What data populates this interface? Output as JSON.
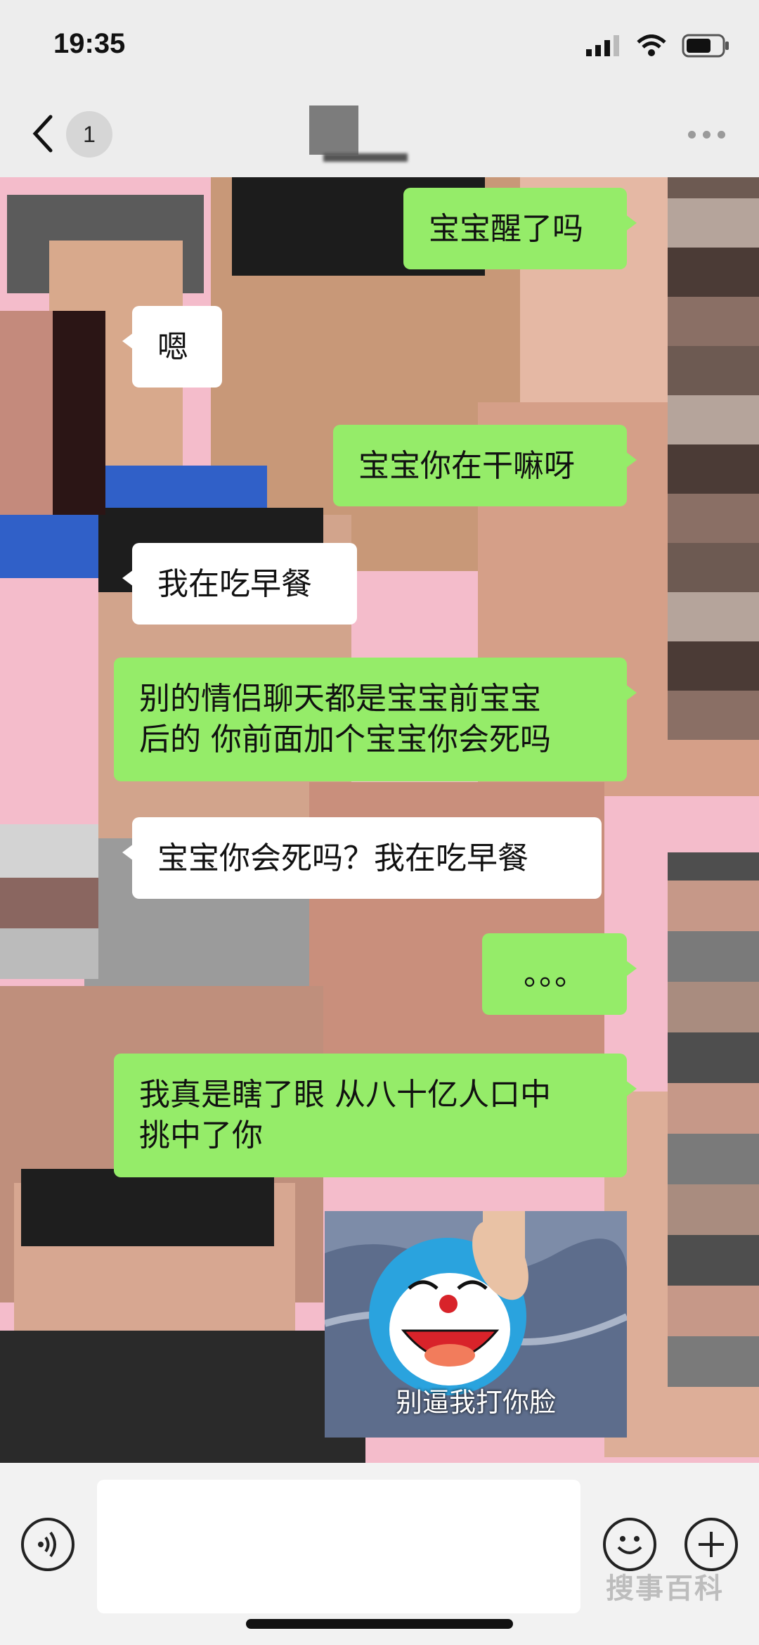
{
  "status_bar": {
    "time": "19:35",
    "icons": [
      "signal-icon",
      "wifi-icon",
      "battery-icon"
    ]
  },
  "header": {
    "back_icon": "chevron-left-icon",
    "unread_count": "1",
    "more_icon": "more-dots-icon"
  },
  "messages": [
    {
      "side": "me",
      "text": "宝宝醒了吗"
    },
    {
      "side": "them",
      "text": "嗯"
    },
    {
      "side": "me",
      "text": "宝宝你在干嘛呀"
    },
    {
      "side": "them",
      "text": "我在吃早餐"
    },
    {
      "side": "me",
      "line1": "别的情侣聊天都是宝宝前宝宝",
      "line2": "后的 你前面加个宝宝你会死吗"
    },
    {
      "side": "them",
      "text": "宝宝你会死吗？我在吃早餐"
    },
    {
      "side": "me",
      "text": "。。。"
    },
    {
      "side": "me",
      "line1": "我真是瞎了眼 从八十亿人口中",
      "line2": "挑中了你"
    },
    {
      "side": "me",
      "type": "sticker",
      "caption": "别逼我打你脸"
    }
  ],
  "input_bar": {
    "voice_icon": "voice-icon",
    "emoji_icon": "emoji-icon",
    "plus_icon": "plus-icon",
    "input_value": ""
  },
  "watermark": "搜事百科",
  "colors": {
    "my_bubble": "#95ec69",
    "their_bubble": "#ffffff",
    "chat_background": "#f4bccb"
  }
}
